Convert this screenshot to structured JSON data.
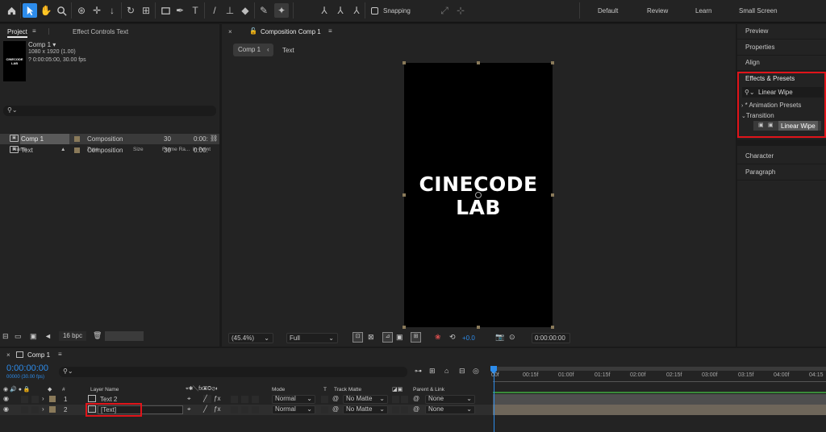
{
  "toolbar": {
    "snapping_label": "Snapping",
    "workspaces": [
      "Default",
      "Review",
      "Learn",
      "Small Screen"
    ]
  },
  "project": {
    "tab_project": "Project",
    "tab_effect_controls": "Effect Controls Text",
    "thumb_text": "CINECODE LAB",
    "selected_name": "Comp 1",
    "selected_info1": "1080 x 1920 (1.00)",
    "selected_info2": "? 0:00:05:00, 30.00 fps",
    "columns": {
      "name": "Name",
      "type": "Type",
      "size": "Size",
      "frame_rate": "Frame Ra...",
      "in_point": "In Point"
    },
    "items": [
      {
        "name": "Comp 1",
        "type": "Composition",
        "frame_rate": "30",
        "in_point": "0:00:"
      },
      {
        "name": "Text",
        "type": "Composition",
        "frame_rate": "30",
        "in_point": "0:00:"
      }
    ],
    "bpc": "16 bpc"
  },
  "viewer": {
    "tab_label": "Composition Comp 1",
    "breadcrumb_comp": "Comp 1",
    "breadcrumb_text": "Text",
    "comp_text_line1": "CINECODE",
    "comp_text_line2": "LAB",
    "zoom": "(45.4%)",
    "resolution": "Full",
    "exposure": "+0.0",
    "timecode": "0:00:00:00"
  },
  "right_panel": {
    "items": [
      "Preview",
      "Properties",
      "Align",
      "Effects & Presets"
    ],
    "search_value": "Linear Wipe",
    "tree_animation_presets": "* Animation Presets",
    "tree_transition": "Transition",
    "tree_linear_wipe": "Linear Wipe",
    "character": "Character",
    "paragraph": "Paragraph"
  },
  "timeline": {
    "tab_label": "Comp 1",
    "timecode": "0:00:00:00",
    "timecode_sub": "00000 (30.00 fps)",
    "columns": {
      "num": "#",
      "layer_name": "Layer Name",
      "mode": "Mode",
      "t": "T",
      "track_matte": "Track Matte",
      "parent": "Parent & Link"
    },
    "ruler": [
      "00f",
      "00:15f",
      "01:00f",
      "01:15f",
      "02:00f",
      "02:15f",
      "03:00f",
      "03:15f",
      "04:00f",
      "04:15"
    ],
    "layers": [
      {
        "num": "1",
        "name": "Text 2",
        "mode": "Normal",
        "matte": "No Matte",
        "parent": "None"
      },
      {
        "num": "2",
        "name": "[Text]",
        "mode": "Normal",
        "matte": "No Matte",
        "parent": "None"
      }
    ]
  },
  "colors": {
    "accent": "#2d8ceb",
    "highlight": "#e0141a",
    "label_tan": "#8a7a5a",
    "green_bar": "#3a8a3a"
  }
}
